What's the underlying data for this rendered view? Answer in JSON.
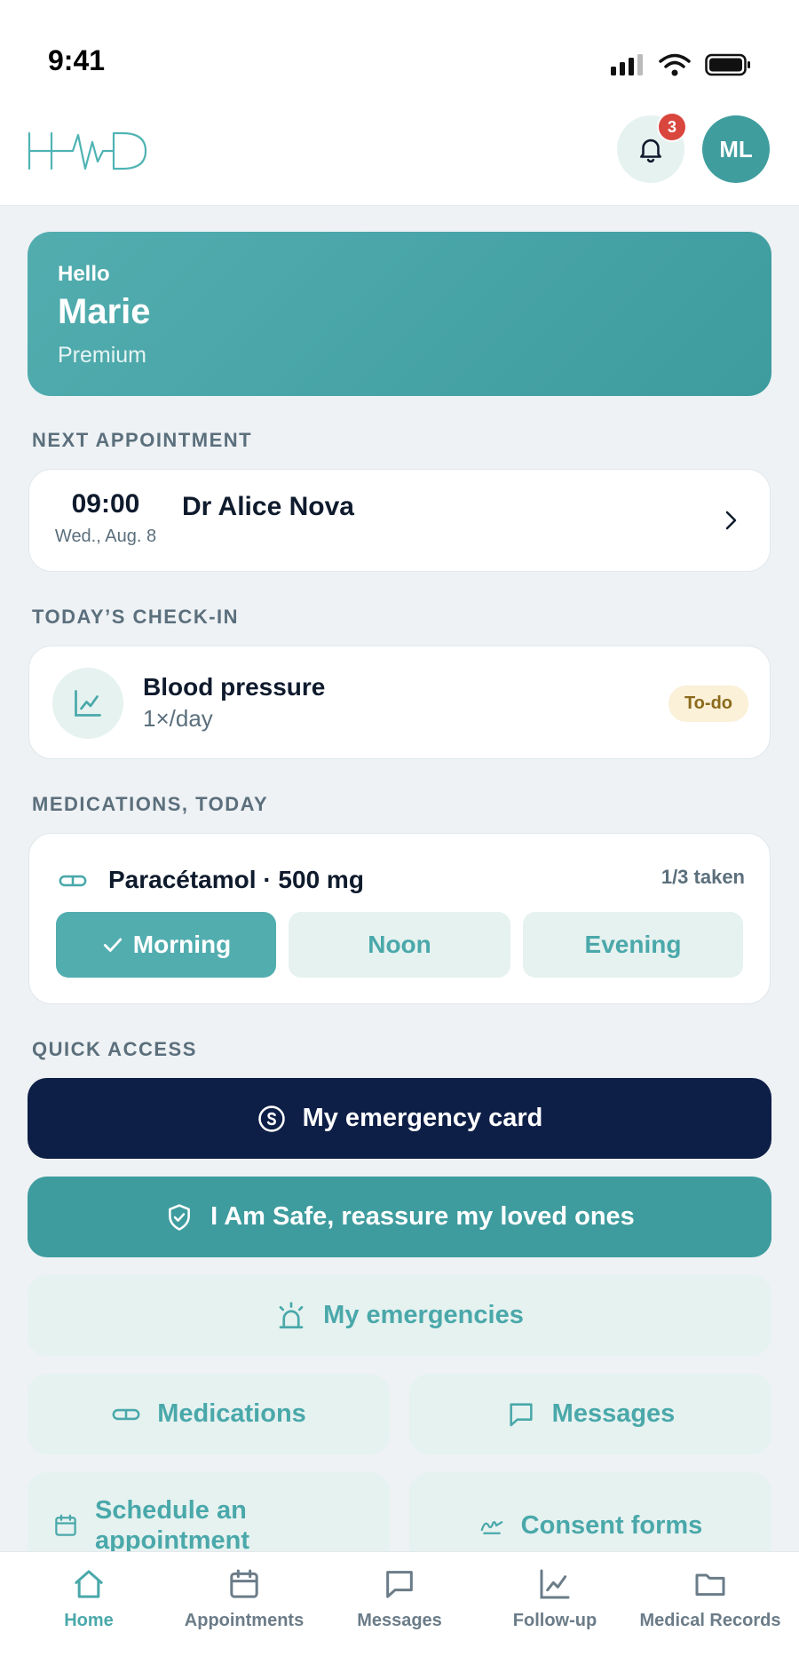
{
  "status_bar": {
    "time": "9:41"
  },
  "header": {
    "notification_count": "3",
    "avatar_initials": "ML"
  },
  "hero": {
    "greeting": "Hello",
    "name": "Marie",
    "plan": "Premium"
  },
  "next_appointment": {
    "section_title": "NEXT APPOINTMENT",
    "time": "09:00",
    "date": "Wed., Aug. 8",
    "doctor": "Dr Alice Nova"
  },
  "checkin": {
    "section_title": "TODAY’S CHECK-IN",
    "title": "Blood pressure",
    "frequency": "1×/day",
    "status": "To-do"
  },
  "medications": {
    "section_title": "MEDICATIONS, TODAY",
    "name": "Paracétamol · 500 mg",
    "progress": "1/3 taken",
    "doses": [
      {
        "label": "Morning",
        "taken": true
      },
      {
        "label": "Noon",
        "taken": false
      },
      {
        "label": "Evening",
        "taken": false
      }
    ]
  },
  "quick_access": {
    "section_title": "QUICK ACCESS",
    "emergency_card": "My emergency card",
    "i_am_safe": "I Am Safe, reassure my loved ones",
    "my_emergencies": "My emergencies",
    "medications": "Medications",
    "messages": "Messages",
    "schedule": "Schedule an appointment",
    "consent": "Consent forms"
  },
  "tabbar": {
    "tabs": [
      {
        "label": "Home",
        "icon": "home-icon"
      },
      {
        "label": "Appointments",
        "icon": "calendar-icon"
      },
      {
        "label": "Messages",
        "icon": "message-icon"
      },
      {
        "label": "Follow-up",
        "icon": "chart-icon"
      },
      {
        "label": "Medical Records",
        "icon": "folder-icon"
      }
    ],
    "active": "Home"
  },
  "colors": {
    "accent": "#4aa8aa",
    "accent_dark": "#3e9c9e",
    "navy": "#0e1f47",
    "badge": "#d9463e",
    "background": "#eef2f5"
  }
}
